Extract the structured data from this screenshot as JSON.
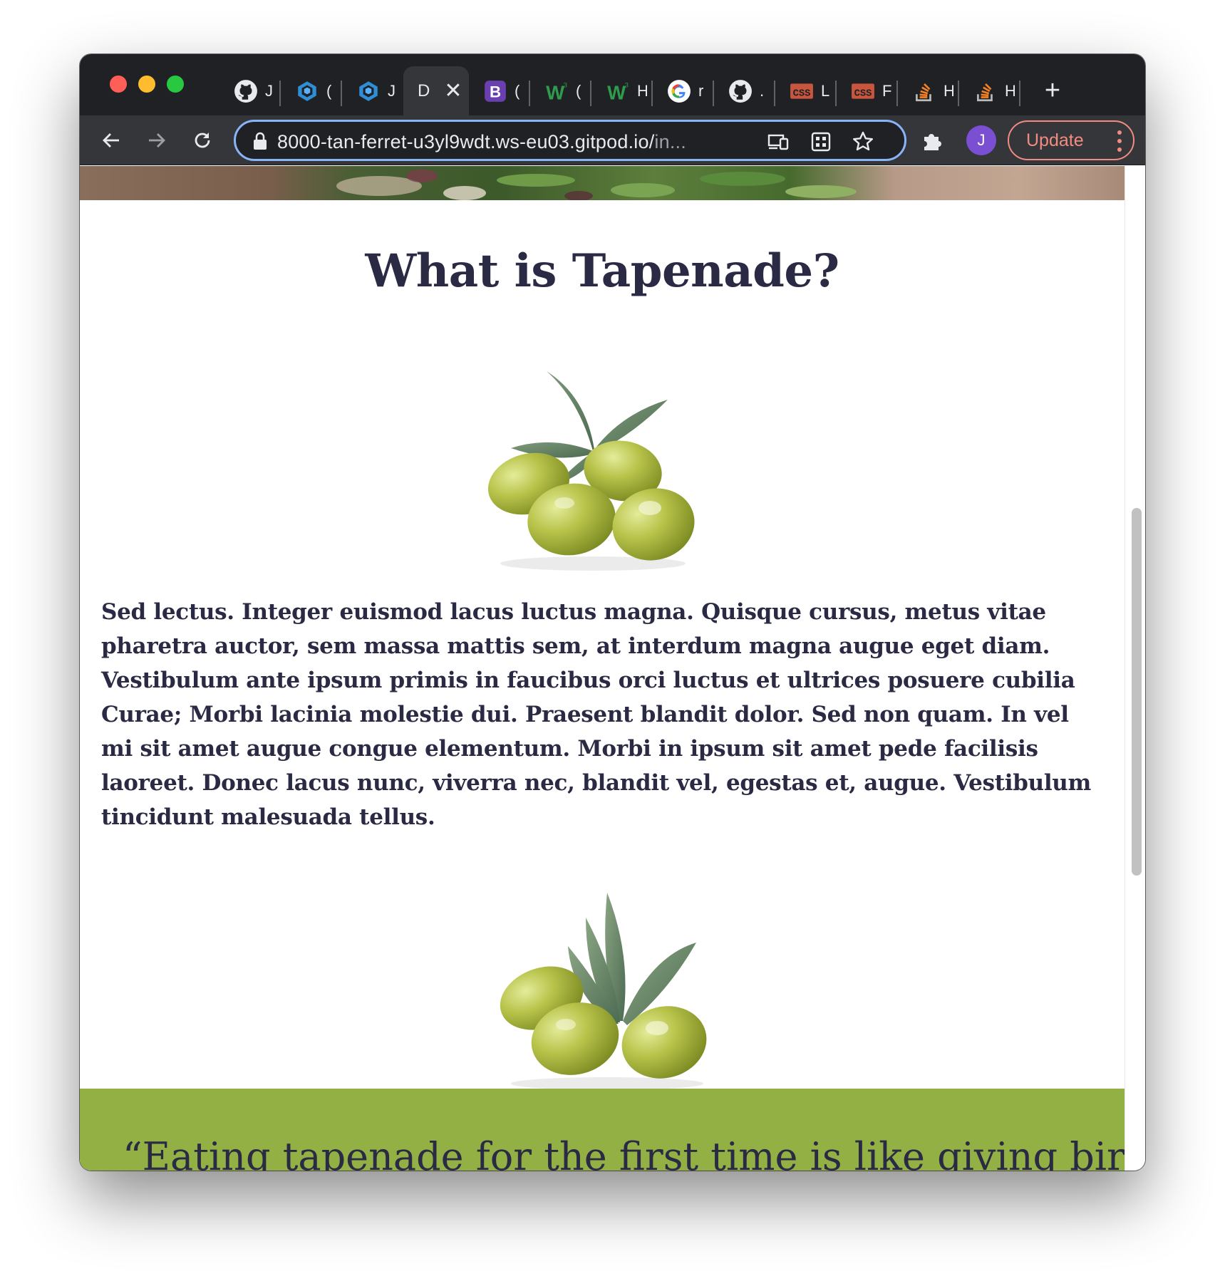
{
  "browser": {
    "tabs": [
      {
        "icon": "github-icon",
        "title": "J"
      },
      {
        "icon": "codesandbox-icon",
        "title": "("
      },
      {
        "icon": "codesandbox-icon",
        "title": "J"
      },
      {
        "icon": "none",
        "title": "D",
        "active": true
      },
      {
        "icon": "bootstrap-icon",
        "title": "("
      },
      {
        "icon": "w3schools-icon",
        "title": "("
      },
      {
        "icon": "w3schools-icon",
        "title": "H"
      },
      {
        "icon": "google-icon",
        "title": "r"
      },
      {
        "icon": "github-icon",
        "title": "."
      },
      {
        "icon": "css-tricks-icon",
        "title": "L"
      },
      {
        "icon": "css-tricks-icon",
        "title": "F"
      },
      {
        "icon": "stackoverflow-icon",
        "title": "H"
      },
      {
        "icon": "stackoverflow-icon",
        "title": "H"
      }
    ],
    "active_tab_close": "✕",
    "new_tab": "+",
    "url_main": "8000-tan-ferret-u3yl9wdt.ws-eu03.gitpod.io/",
    "url_dim": "in...",
    "profile_initial": "J",
    "update_label": "Update"
  },
  "page": {
    "heading": "What is Tapenade?",
    "paragraph": "Sed lectus. Integer euismod lacus luctus magna. Quisque cursus, metus vitae pharetra auctor, sem massa mattis sem, at interdum magna augue eget diam. Vestibulum ante ipsum primis in faucibus orci luctus et ultrices posuere cubilia Curae; Morbi lacinia molestie dui. Praesent blandit dolor. Sed non quam. In vel mi sit amet augue congue elementum. Morbi in ipsum sit amet pede facilisis laoreet. Donec lacus nunc, viverra nec, blandit vel, egestas et, augue. Vestibulum tincidunt malesuada tellus.",
    "quote": "“Eating tapenade for the first time is like giving birth"
  },
  "colors": {
    "heading_text": "#2b2a44",
    "quote_band": "#93b045",
    "update_accent": "#f28b82",
    "focus_ring": "#8ab4f8"
  }
}
